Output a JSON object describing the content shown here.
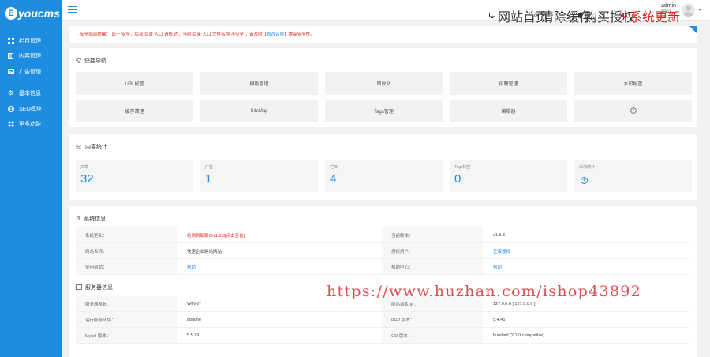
{
  "brand": {
    "mark": "E",
    "name": "youcms"
  },
  "sidebar": {
    "items": [
      {
        "label": "栏目管理",
        "icon": "grid-icon"
      },
      {
        "label": "内容管理",
        "icon": "document-icon"
      },
      {
        "label": "广告管理",
        "icon": "image-icon"
      },
      {
        "label": "基本信息",
        "icon": "gear-icon"
      },
      {
        "label": "SEO模块",
        "icon": "globe-icon"
      },
      {
        "label": "更多功能",
        "icon": "apps-icon"
      }
    ]
  },
  "topbar": {
    "links": [
      {
        "label": "网站首页",
        "icon": "monitor-icon"
      },
      {
        "label": "清除缓存",
        "icon": "refresh-icon"
      },
      {
        "label": "购买授权",
        "icon": "bookmark-icon"
      },
      {
        "label": "系统更新",
        "icon": "alert-icon"
      }
    ],
    "user": {
      "name": "admin",
      "role": "超级A"
    }
  },
  "notice": {
    "text_before": "· 安全隐患提醒： 出于 安全，后台 目录 入口 请修 改，当前 目录 入口 文件名称 不安全 ，请及时【",
    "link": "修改名称",
    "text_after": "】提高安全性。"
  },
  "quick_nav": {
    "title": "快捷导航",
    "buttons": [
      "URL配置",
      "模板管理",
      "回收站",
      "招聘管理",
      "水印配置",
      "缓存清理",
      "SiteMap",
      "Tags管理",
      "编辑器",
      ""
    ]
  },
  "stats": {
    "title": "内容统计",
    "items": [
      {
        "label": "文章",
        "value": "32"
      },
      {
        "label": "广告",
        "value": "1"
      },
      {
        "label": "栏目",
        "value": "4"
      },
      {
        "label": "Tags标签",
        "value": "0"
      },
      {
        "label": "添加统计",
        "value": ""
      }
    ]
  },
  "system": {
    "title": "系统信息",
    "rows": [
      {
        "k1": "系统更新：",
        "v1": "检测到新版本v1.5.3[点击查看]",
        "k2": "当前版本：",
        "v2": "v1.5.3"
      },
      {
        "k1": "网站名称：",
        "v1": "快速企业建站网站",
        "k2": "授权用户：",
        "v2": "正版授权"
      },
      {
        "k1": "使用帮助：",
        "v1": "帮助",
        "k2": "帮助中心：",
        "v2": "帮助"
      }
    ]
  },
  "server": {
    "title": "服务器信息",
    "rows": [
      {
        "k1": "服务器系统：",
        "v1": "WINNT",
        "k2": "网站域名/IP：",
        "v2": "127.0.0.6 [ 127.0.0.6 ]"
      },
      {
        "k1": "运行服务环境：",
        "v1": "apache",
        "k2": "PHP 版本：",
        "v2": "5.4.45"
      },
      {
        "k1": "Mysql 版本：",
        "v1": "5.5.29",
        "k2": "GD 版本：",
        "v2": "bundled (2.1.0 compatible)"
      }
    ]
  },
  "watermark": "https://www.huzhan.com/ishop43892",
  "colors": {
    "accent": "#1e8de0",
    "alert": "#e02020"
  }
}
